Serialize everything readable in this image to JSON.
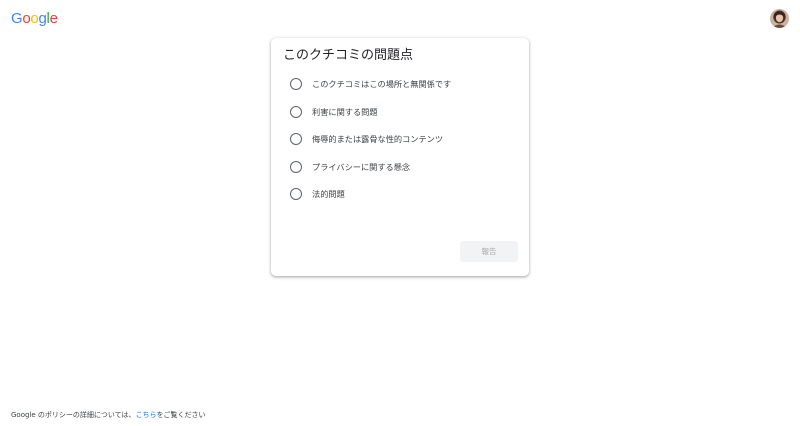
{
  "header": {
    "logo_letters": [
      "G",
      "o",
      "o",
      "g",
      "l",
      "e"
    ],
    "logo_colors": [
      "#4285F4",
      "#EA4335",
      "#FBBC05",
      "#4285F4",
      "#34A853",
      "#EA4335"
    ]
  },
  "dialog": {
    "title": "このクチコミの問題点",
    "options": [
      {
        "label": "このクチコミはこの場所と無関係です",
        "selected": false
      },
      {
        "label": "利害に関する問題",
        "selected": false
      },
      {
        "label": "侮辱的または露骨な性的コンテンツ",
        "selected": false
      },
      {
        "label": "プライバシーに関する懸念",
        "selected": false
      },
      {
        "label": "法的問題",
        "selected": false
      }
    ],
    "report_button": "報告",
    "report_enabled": false
  },
  "footer": {
    "text_before": "Google のポリシーの詳細については、",
    "link_text": "こちら",
    "text_after": "をご覧ください"
  },
  "colors": {
    "accent": "#1a73e8",
    "radio_border": "#5f6368",
    "disabled_button_bg": "#f1f3f4",
    "disabled_button_text": "#a8a9ac"
  }
}
